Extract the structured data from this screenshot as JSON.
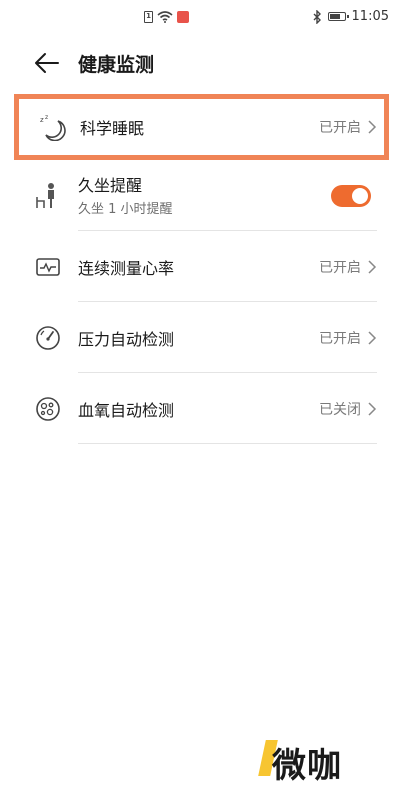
{
  "status_bar": {
    "sim_label": "1",
    "time": "11:05",
    "icons": [
      "sim-icon",
      "wifi-icon",
      "home-icon",
      "bluetooth-icon",
      "battery-icon"
    ]
  },
  "header": {
    "title": "健康监测",
    "back_icon": "arrow-left-icon"
  },
  "items": [
    {
      "icon": "sleep-moon-icon",
      "title": "科学睡眠",
      "status": "已开启",
      "highlighted": true
    },
    {
      "icon": "sitting-person-icon",
      "title": "久坐提醒",
      "subtitle": "久坐 1 小时提醒",
      "toggle_on": true
    },
    {
      "icon": "heart-rate-monitor-icon",
      "title": "连续测量心率",
      "status": "已开启"
    },
    {
      "icon": "pressure-gauge-icon",
      "title": "压力自动检测",
      "status": "已开启"
    },
    {
      "icon": "blood-oxygen-icon",
      "title": "血氧自动检测",
      "status": "已关闭"
    }
  ],
  "watermark": {
    "text": "微咖"
  },
  "colors": {
    "highlight_border": "#f08456",
    "toggle_on": "#ee6b2f",
    "watermark_accent": "#f7c531"
  }
}
